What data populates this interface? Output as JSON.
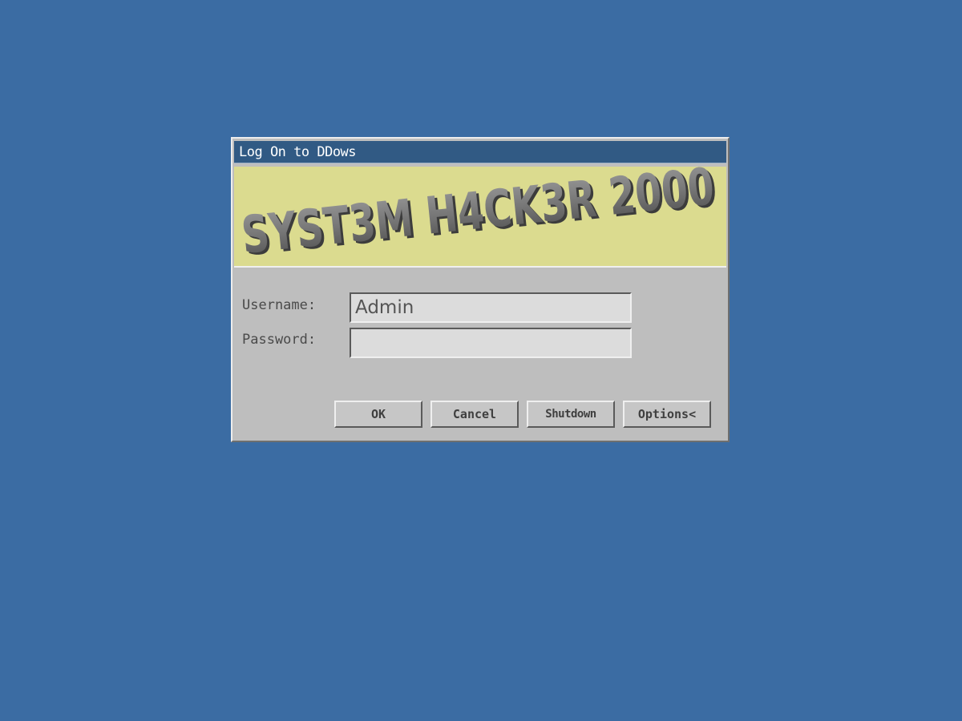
{
  "dialog": {
    "title": "Log On to DDows",
    "banner_text": "SYST3M H4CK3R 2000",
    "username_label": "Username:",
    "password_label": "Password:",
    "username_value": "Admin",
    "password_value": "",
    "buttons": {
      "ok": "OK",
      "cancel": "Cancel",
      "shutdown": "Shutdown",
      "options": "Options<"
    }
  },
  "colors": {
    "desktop": "#3b6ca3",
    "titlebar": "#315a84",
    "banner": "#dbdb8f",
    "dialog": "#bebebe"
  }
}
